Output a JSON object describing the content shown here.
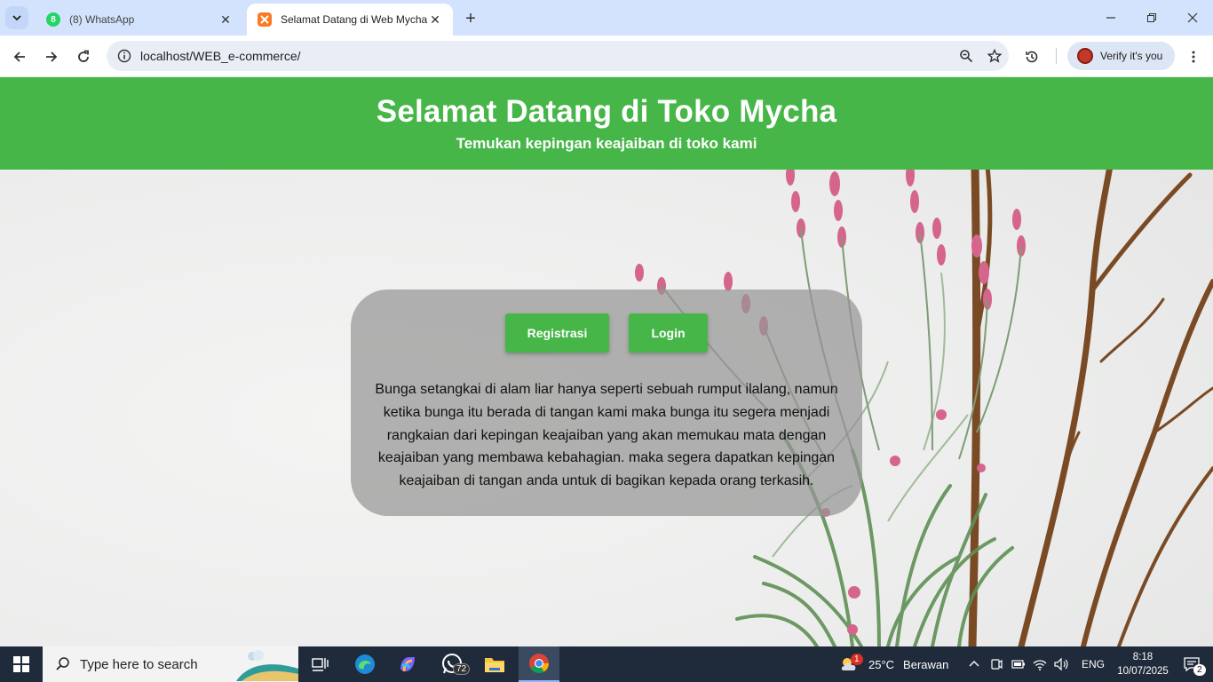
{
  "browser": {
    "tabs": [
      {
        "title": "(8) WhatsApp",
        "badge": "8",
        "active": false
      },
      {
        "title": "Selamat Datang di Web Mycha",
        "active": true
      }
    ],
    "url": "localhost/WEB_e-commerce/",
    "profile_label": "Verify it's you"
  },
  "header": {
    "title": "Selamat Datang di Toko Mycha",
    "subtitle": "Temukan kepingan keajaiban di toko kami"
  },
  "card": {
    "register_label": "Registrasi",
    "login_label": "Login",
    "description": "Bunga setangkai di alam liar hanya seperti sebuah rumput ilalang, namun ketika bunga itu berada di tangan kami maka bunga itu segera menjadi rangkaian dari kepingan keajaiban yang akan memukau mata dengan keajaiban yang membawa kebahagian. maka segera dapatkan kepingan keajaiban di tangan anda untuk di bagikan kepada orang terkasih."
  },
  "taskbar": {
    "search_placeholder": "Type here to search",
    "whatsapp_badge": "72",
    "weather_badge": "1",
    "weather_temp": "25°C",
    "weather_desc": "Berawan",
    "language": "ENG",
    "time": "8:18",
    "date": "10/07/2025",
    "notifications": "2"
  },
  "colors": {
    "brand_green": "#47b649",
    "tabstrip": "#d3e3fd",
    "taskbar": "#1f2a3a"
  }
}
